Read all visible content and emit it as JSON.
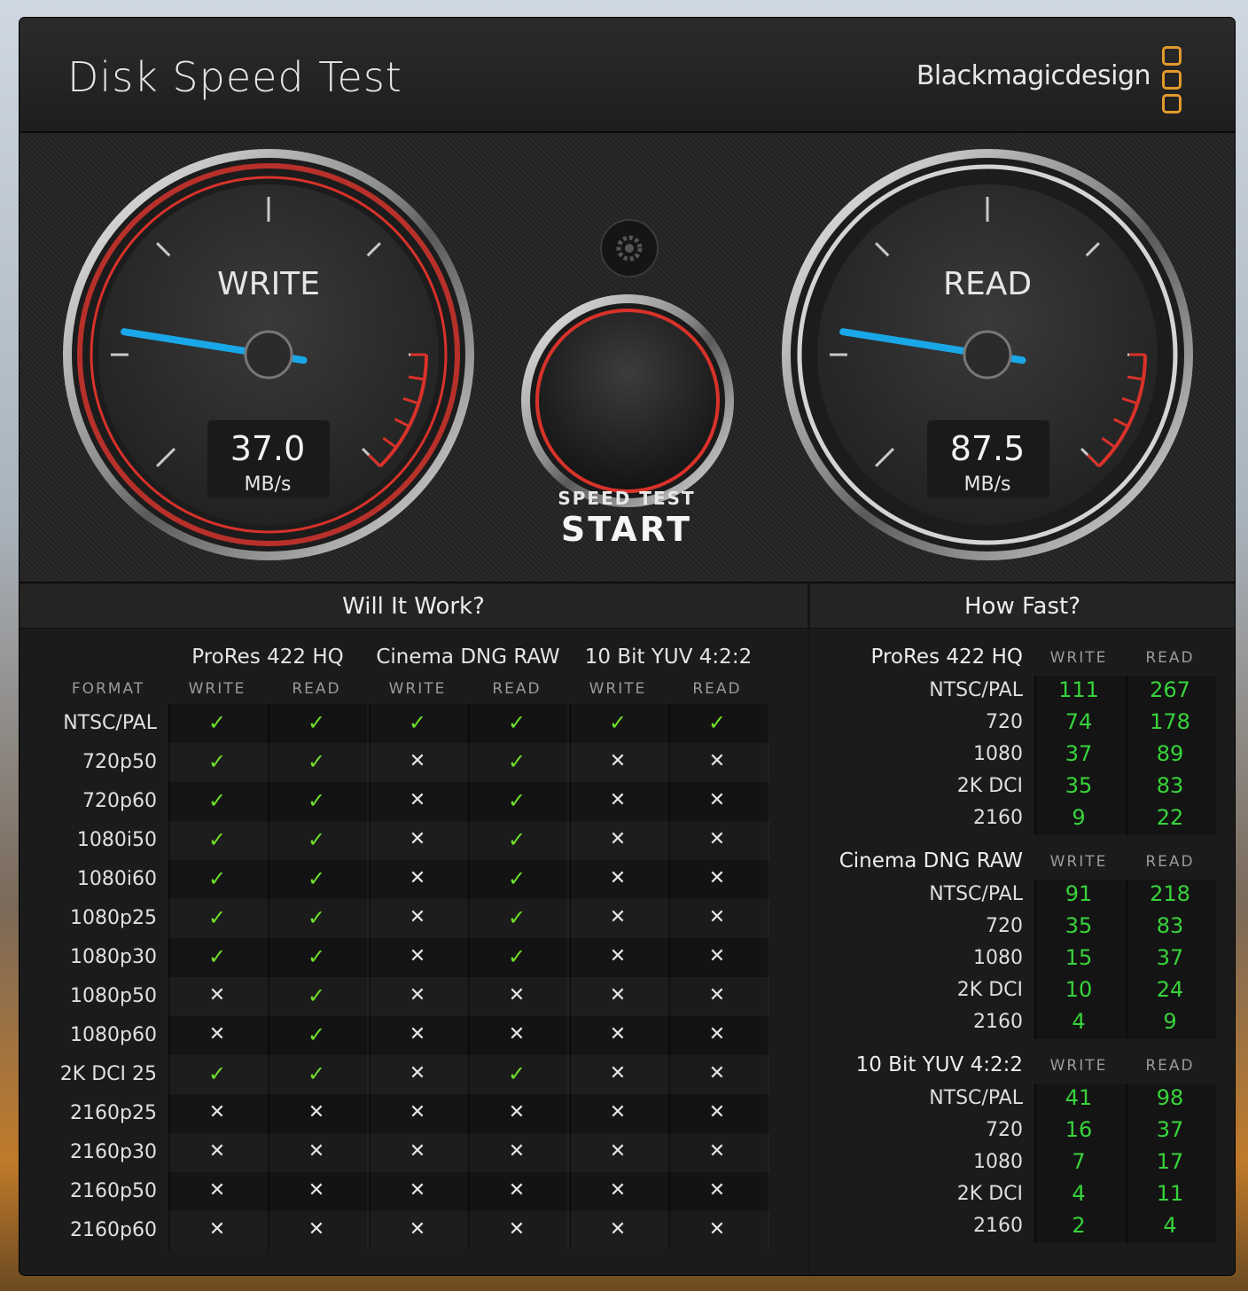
{
  "window": {
    "close_label": "✕",
    "title": "Disk Speed Test",
    "brand": "Blackmagicdesign"
  },
  "gauges": {
    "write": {
      "label": "WRITE",
      "value": "37.0",
      "unit": "MB/s",
      "needle_fraction": 0.2
    },
    "read": {
      "label": "READ",
      "value": "87.5",
      "unit": "MB/s",
      "needle_fraction": 0.2
    }
  },
  "start_button": {
    "top": "SPEED TEST",
    "main": "START"
  },
  "settings": {
    "icon": "gear-icon"
  },
  "will_it_work": {
    "title": "Will It Work?",
    "format_label": "FORMAT",
    "groups": [
      {
        "name": "ProRes 422 HQ",
        "write": "WRITE",
        "read": "READ"
      },
      {
        "name": "Cinema DNG RAW",
        "write": "WRITE",
        "read": "READ"
      },
      {
        "name": "10 Bit YUV 4:2:2",
        "write": "WRITE",
        "read": "READ"
      }
    ],
    "rows": [
      {
        "format": "NTSC/PAL",
        "v": [
          1,
          1,
          1,
          1,
          1,
          1
        ]
      },
      {
        "format": "720p50",
        "v": [
          1,
          1,
          0,
          1,
          0,
          0
        ]
      },
      {
        "format": "720p60",
        "v": [
          1,
          1,
          0,
          1,
          0,
          0
        ]
      },
      {
        "format": "1080i50",
        "v": [
          1,
          1,
          0,
          1,
          0,
          0
        ]
      },
      {
        "format": "1080i60",
        "v": [
          1,
          1,
          0,
          1,
          0,
          0
        ]
      },
      {
        "format": "1080p25",
        "v": [
          1,
          1,
          0,
          1,
          0,
          0
        ]
      },
      {
        "format": "1080p30",
        "v": [
          1,
          1,
          0,
          1,
          0,
          0
        ]
      },
      {
        "format": "1080p50",
        "v": [
          0,
          1,
          0,
          0,
          0,
          0
        ]
      },
      {
        "format": "1080p60",
        "v": [
          0,
          1,
          0,
          0,
          0,
          0
        ]
      },
      {
        "format": "2K DCI 25",
        "v": [
          1,
          1,
          0,
          1,
          0,
          0
        ]
      },
      {
        "format": "2160p25",
        "v": [
          0,
          0,
          0,
          0,
          0,
          0
        ]
      },
      {
        "format": "2160p30",
        "v": [
          0,
          0,
          0,
          0,
          0,
          0
        ]
      },
      {
        "format": "2160p50",
        "v": [
          0,
          0,
          0,
          0,
          0,
          0
        ]
      },
      {
        "format": "2160p60",
        "v": [
          0,
          0,
          0,
          0,
          0,
          0
        ]
      }
    ],
    "check_glyph": "✓",
    "cross_glyph": "✕"
  },
  "how_fast": {
    "title": "How Fast?",
    "sections": [
      {
        "name": "ProRes 422 HQ",
        "write": "WRITE",
        "read": "READ",
        "rows": [
          [
            "NTSC/PAL",
            "111",
            "267"
          ],
          [
            "720",
            "74",
            "178"
          ],
          [
            "1080",
            "37",
            "89"
          ],
          [
            "2K DCI",
            "35",
            "83"
          ],
          [
            "2160",
            "9",
            "22"
          ]
        ]
      },
      {
        "name": "Cinema DNG RAW",
        "write": "WRITE",
        "read": "READ",
        "rows": [
          [
            "NTSC/PAL",
            "91",
            "218"
          ],
          [
            "720",
            "35",
            "83"
          ],
          [
            "1080",
            "15",
            "37"
          ],
          [
            "2K DCI",
            "10",
            "24"
          ],
          [
            "2160",
            "4",
            "9"
          ]
        ]
      },
      {
        "name": "10 Bit YUV 4:2:2",
        "write": "WRITE",
        "read": "READ",
        "rows": [
          [
            "NTSC/PAL",
            "41",
            "98"
          ],
          [
            "720",
            "16",
            "37"
          ],
          [
            "1080",
            "7",
            "17"
          ],
          [
            "2K DCI",
            "4",
            "11"
          ],
          [
            "2160",
            "2",
            "4"
          ]
        ]
      }
    ]
  },
  "colors": {
    "accent_green": "#6fe02a",
    "value_green": "#38d33b",
    "needle": "#1aa7e8",
    "red": "#d8322a",
    "brand_orange": "#e29a2c"
  }
}
